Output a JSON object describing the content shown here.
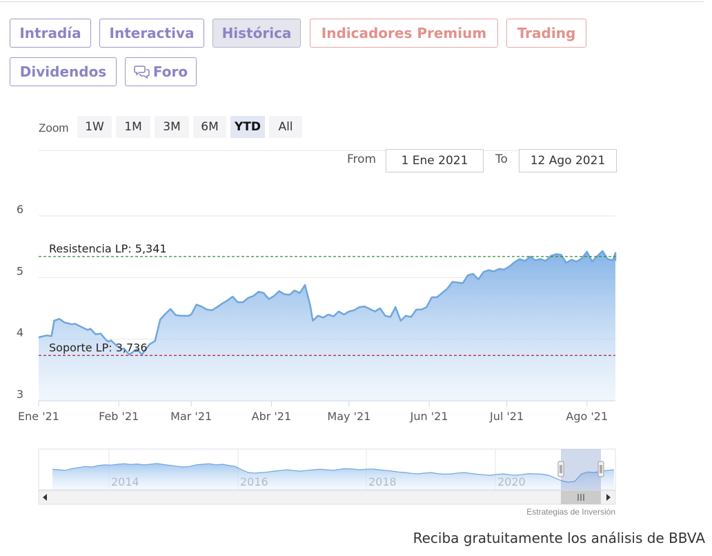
{
  "tabs": [
    {
      "label": "Intradía",
      "style": "purple",
      "active": false
    },
    {
      "label": "Interactiva",
      "style": "purple",
      "active": false
    },
    {
      "label": "Histórica",
      "style": "purple",
      "active": true
    },
    {
      "label": "Indicadores Premium",
      "style": "red",
      "active": false
    },
    {
      "label": "Trading",
      "style": "red",
      "active": false
    },
    {
      "label": "Dividendos",
      "style": "purple",
      "active": false
    },
    {
      "label": "Foro",
      "style": "purple",
      "active": false,
      "icon": "chat-bubbles-icon"
    }
  ],
  "zoom": {
    "label": "Zoom",
    "buttons": [
      "1W",
      "1M",
      "3M",
      "6M",
      "YTD",
      "All"
    ],
    "selected": "YTD"
  },
  "range": {
    "from_label": "From",
    "from_value": "1 Ene 2021",
    "to_label": "To",
    "to_value": "12 Ago 2021"
  },
  "chart_data": {
    "type": "area",
    "title": "",
    "xlabel": "",
    "ylabel": "",
    "ylim": [
      3,
      6
    ],
    "yticks": [
      3,
      4,
      5,
      6
    ],
    "xticks": [
      {
        "label": "Ene '21",
        "date": "2021-01-01"
      },
      {
        "label": "Feb '21",
        "date": "2021-02-01"
      },
      {
        "label": "Mar '21",
        "date": "2021-03-01"
      },
      {
        "label": "Abr '21",
        "date": "2021-04-01"
      },
      {
        "label": "May '21",
        "date": "2021-05-01"
      },
      {
        "label": "Jun '21",
        "date": "2021-06-01"
      },
      {
        "label": "Jul '21",
        "date": "2021-07-01"
      },
      {
        "label": "Ago '21",
        "date": "2021-08-01"
      }
    ],
    "xrange": [
      "2021-01-01",
      "2021-08-12"
    ],
    "series": [
      {
        "color": "#6fa6dc",
        "points": [
          [
            "2021-01-01",
            4.03
          ],
          [
            "2021-01-04",
            4.06
          ],
          [
            "2021-01-06",
            4.05
          ],
          [
            "2021-01-07",
            4.3
          ],
          [
            "2021-01-09",
            4.33
          ],
          [
            "2021-01-11",
            4.27
          ],
          [
            "2021-01-14",
            4.24
          ],
          [
            "2021-01-15",
            4.25
          ],
          [
            "2021-01-18",
            4.19
          ],
          [
            "2021-01-20",
            4.15
          ],
          [
            "2021-01-21",
            4.17
          ],
          [
            "2021-01-23",
            4.08
          ],
          [
            "2021-01-25",
            4.09
          ],
          [
            "2021-01-27",
            3.99
          ],
          [
            "2021-01-28",
            3.96
          ],
          [
            "2021-01-29",
            3.98
          ],
          [
            "2021-01-31",
            3.9
          ],
          [
            "2021-02-02",
            3.84
          ],
          [
            "2021-02-03",
            3.85
          ],
          [
            "2021-02-05",
            3.75
          ],
          [
            "2021-02-08",
            3.84
          ],
          [
            "2021-02-10",
            3.75
          ],
          [
            "2021-02-11",
            3.82
          ],
          [
            "2021-02-13",
            3.92
          ],
          [
            "2021-02-15",
            3.97
          ],
          [
            "2021-02-17",
            4.32
          ],
          [
            "2021-02-19",
            4.41
          ],
          [
            "2021-02-21",
            4.49
          ],
          [
            "2021-02-23",
            4.39
          ],
          [
            "2021-02-25",
            4.38
          ],
          [
            "2021-02-28",
            4.38
          ],
          [
            "2021-03-01",
            4.4
          ],
          [
            "2021-03-03",
            4.56
          ],
          [
            "2021-03-05",
            4.53
          ],
          [
            "2021-03-07",
            4.48
          ],
          [
            "2021-03-09",
            4.47
          ],
          [
            "2021-03-11",
            4.52
          ],
          [
            "2021-03-13",
            4.58
          ],
          [
            "2021-03-15",
            4.63
          ],
          [
            "2021-03-17",
            4.69
          ],
          [
            "2021-03-19",
            4.6
          ],
          [
            "2021-03-21",
            4.6
          ],
          [
            "2021-03-23",
            4.67
          ],
          [
            "2021-03-25",
            4.7
          ],
          [
            "2021-03-27",
            4.77
          ],
          [
            "2021-03-29",
            4.75
          ],
          [
            "2021-03-31",
            4.65
          ],
          [
            "2021-04-02",
            4.7
          ],
          [
            "2021-04-04",
            4.78
          ],
          [
            "2021-04-06",
            4.73
          ],
          [
            "2021-04-08",
            4.72
          ],
          [
            "2021-04-10",
            4.79
          ],
          [
            "2021-04-12",
            4.75
          ],
          [
            "2021-04-14",
            4.88
          ],
          [
            "2021-04-16",
            4.55
          ],
          [
            "2021-04-17",
            4.3
          ],
          [
            "2021-04-19",
            4.38
          ],
          [
            "2021-04-21",
            4.35
          ],
          [
            "2021-04-23",
            4.4
          ],
          [
            "2021-04-25",
            4.37
          ],
          [
            "2021-04-27",
            4.45
          ],
          [
            "2021-04-29",
            4.4
          ],
          [
            "2021-05-01",
            4.45
          ],
          [
            "2021-05-03",
            4.47
          ],
          [
            "2021-05-05",
            4.52
          ],
          [
            "2021-05-07",
            4.53
          ],
          [
            "2021-05-09",
            4.49
          ],
          [
            "2021-05-11",
            4.45
          ],
          [
            "2021-05-13",
            4.5
          ],
          [
            "2021-05-15",
            4.38
          ],
          [
            "2021-05-17",
            4.36
          ],
          [
            "2021-05-19",
            4.52
          ],
          [
            "2021-05-21",
            4.3
          ],
          [
            "2021-05-23",
            4.38
          ],
          [
            "2021-05-25",
            4.36
          ],
          [
            "2021-05-27",
            4.48
          ],
          [
            "2021-05-29",
            4.48
          ],
          [
            "2021-05-31",
            4.52
          ],
          [
            "2021-06-02",
            4.68
          ],
          [
            "2021-06-04",
            4.68
          ],
          [
            "2021-06-06",
            4.75
          ],
          [
            "2021-06-08",
            4.82
          ],
          [
            "2021-06-10",
            4.93
          ],
          [
            "2021-06-12",
            4.92
          ],
          [
            "2021-06-14",
            4.91
          ],
          [
            "2021-06-16",
            5.04
          ],
          [
            "2021-06-18",
            5.06
          ],
          [
            "2021-06-20",
            4.97
          ],
          [
            "2021-06-22",
            5.09
          ],
          [
            "2021-06-24",
            5.12
          ],
          [
            "2021-06-26",
            5.1
          ],
          [
            "2021-06-28",
            5.14
          ],
          [
            "2021-06-30",
            5.13
          ],
          [
            "2021-07-02",
            5.18
          ],
          [
            "2021-07-04",
            5.25
          ],
          [
            "2021-07-06",
            5.3
          ],
          [
            "2021-07-08",
            5.27
          ],
          [
            "2021-07-10",
            5.34
          ],
          [
            "2021-07-12",
            5.28
          ],
          [
            "2021-07-14",
            5.3
          ],
          [
            "2021-07-16",
            5.27
          ],
          [
            "2021-07-18",
            5.35
          ],
          [
            "2021-07-20",
            5.38
          ],
          [
            "2021-07-22",
            5.37
          ],
          [
            "2021-07-24",
            5.24
          ],
          [
            "2021-07-26",
            5.29
          ],
          [
            "2021-07-28",
            5.26
          ],
          [
            "2021-07-30",
            5.31
          ],
          [
            "2021-08-01",
            5.42
          ],
          [
            "2021-08-03",
            5.26
          ],
          [
            "2021-08-05",
            5.35
          ],
          [
            "2021-08-07",
            5.43
          ],
          [
            "2021-08-09",
            5.3
          ],
          [
            "2021-08-11",
            5.28
          ],
          [
            "2021-08-13",
            5.4
          ],
          [
            "2021-08-15",
            5.27
          ]
        ]
      }
    ],
    "reference_lines": [
      {
        "label": "Resistencia LP: 5,341",
        "value": 5.341,
        "color": "#2e8b2e"
      },
      {
        "label": "Soporte LP: 3,736",
        "value": 3.736,
        "color": "#b11f2e"
      }
    ],
    "navigator": {
      "labels": [
        "2014",
        "2016",
        "2018",
        "2020"
      ],
      "values": [
        0.62,
        0.6,
        0.58,
        0.64,
        0.68,
        0.72,
        0.7,
        0.75,
        0.78,
        0.77,
        0.8,
        0.82,
        0.79,
        0.81,
        0.78,
        0.8,
        0.83,
        0.79,
        0.76,
        0.73,
        0.7,
        0.72,
        0.78,
        0.8,
        0.82,
        0.78,
        0.8,
        0.76,
        0.72,
        0.6,
        0.5,
        0.48,
        0.5,
        0.52,
        0.55,
        0.58,
        0.6,
        0.57,
        0.55,
        0.58,
        0.6,
        0.62,
        0.6,
        0.58,
        0.62,
        0.64,
        0.63,
        0.6,
        0.62,
        0.63,
        0.6,
        0.58,
        0.55,
        0.52,
        0.5,
        0.47,
        0.45,
        0.48,
        0.5,
        0.46,
        0.44,
        0.45,
        0.48,
        0.5,
        0.47,
        0.44,
        0.42,
        0.4,
        0.43,
        0.45,
        0.42,
        0.4,
        0.43,
        0.46,
        0.45,
        0.44,
        0.4,
        0.3,
        0.2,
        0.15,
        0.18,
        0.45,
        0.52,
        0.5,
        0.55,
        0.58,
        0.6
      ]
    }
  },
  "credit": "Estrategias de Inversión",
  "cta": "Reciba gratuitamente los análisis de BBVA"
}
